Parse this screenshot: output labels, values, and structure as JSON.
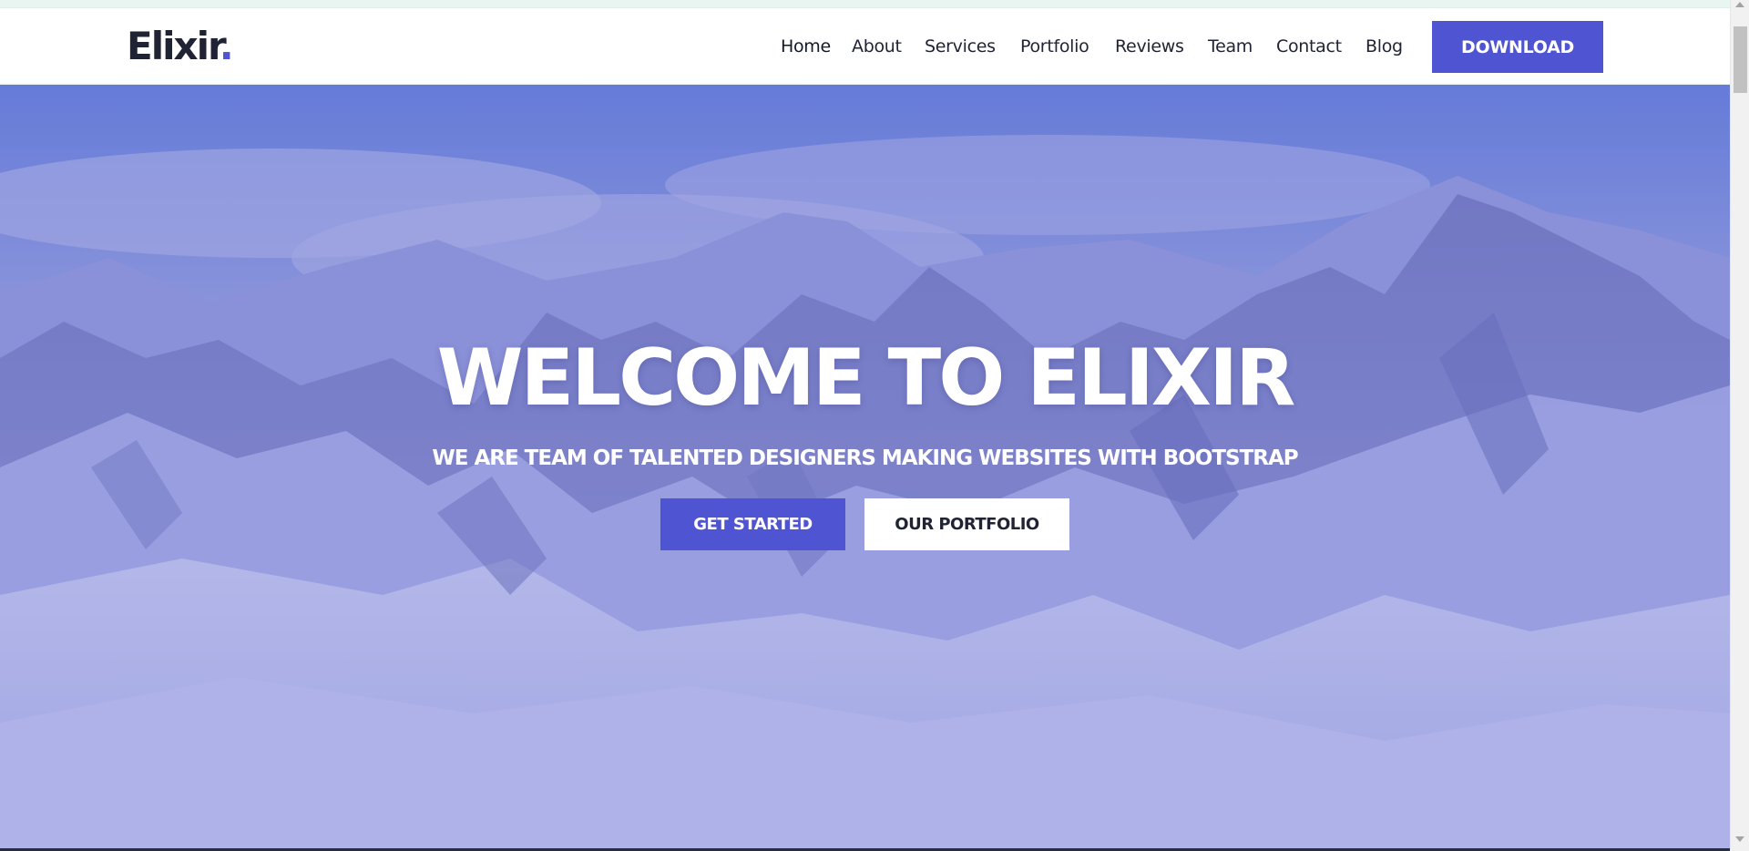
{
  "brand": {
    "name": "Elixir",
    "dot": ".",
    "accent_color": "#4f55d2",
    "text_color": "#1f2333"
  },
  "nav": {
    "items": [
      {
        "label": "Home",
        "active": true
      },
      {
        "label": "About"
      },
      {
        "label": "Services"
      },
      {
        "label": "Portfolio"
      },
      {
        "label": "Reviews"
      },
      {
        "label": "Team"
      },
      {
        "label": "Contact"
      },
      {
        "label": "Blog"
      }
    ],
    "download_label": "DOWNLOAD"
  },
  "hero": {
    "title": "WELCOME TO ELIXIR",
    "subtitle": "WE ARE TEAM OF TALENTED DESIGNERS MAKING WEBSITES WITH BOOTSTRAP",
    "primary_button": "GET STARTED",
    "secondary_button": "OUR PORTFOLIO",
    "background_image": "snowy-mountains"
  }
}
